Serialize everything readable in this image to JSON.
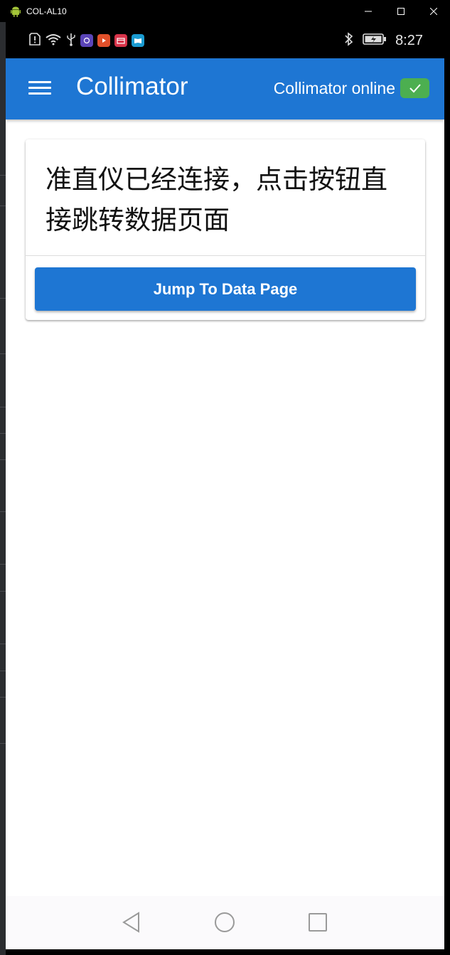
{
  "window": {
    "title": "COL-AL10",
    "controls": [
      "minimize-icon",
      "maximize-icon",
      "close-icon"
    ]
  },
  "status_bar": {
    "time": "8:27",
    "icons": [
      "sim-alert-icon",
      "wifi-icon",
      "usb-icon",
      "app-icon-purple",
      "app-icon-video",
      "app-icon-calendar",
      "app-icon-book",
      "bluetooth-icon",
      "battery-icon"
    ]
  },
  "app_bar": {
    "title": "Collimator",
    "status_text": "Collimator online",
    "status_icon": "check-icon",
    "colors": {
      "primary": "#1e76d3",
      "online": "#4caf50"
    }
  },
  "card": {
    "message": "准直仪已经连接，点击按钮直接跳转数据页面",
    "button_label": "Jump To Data Page"
  },
  "nav_bar": {
    "buttons": [
      "back-icon",
      "home-icon",
      "recents-icon"
    ]
  }
}
